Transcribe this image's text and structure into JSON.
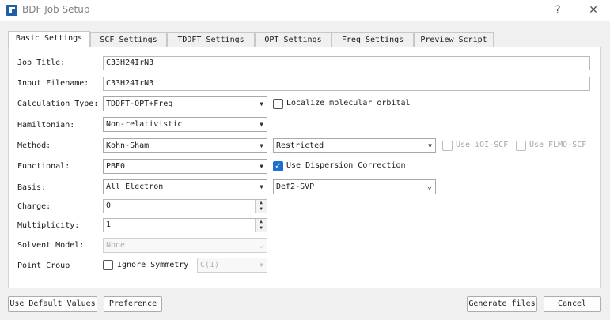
{
  "window": {
    "title": "BDF Job Setup",
    "help_glyph": "?",
    "close_glyph": "✕",
    "icon": "bdf-app-icon"
  },
  "tabs": [
    {
      "label": "Basic Settings",
      "active": true
    },
    {
      "label": "SCF Settings",
      "active": false
    },
    {
      "label": "TDDFT Settings",
      "active": false
    },
    {
      "label": "OPT Settings",
      "active": false
    },
    {
      "label": "Freq Settings",
      "active": false
    },
    {
      "label": "Preview Script",
      "active": false
    }
  ],
  "form": {
    "job_title": {
      "label": "Job Title:",
      "value": "C33H24IrN3"
    },
    "input_filename": {
      "label": "Input Filename:",
      "value": "C33H24IrN3"
    },
    "calculation_type": {
      "label": "Calculation Type:",
      "value": "TDDFT-OPT+Freq"
    },
    "localize_orbital": {
      "label": "Localize molecular orbital",
      "checked": false
    },
    "hamiltonian": {
      "label": "Hamiltonian:",
      "value": "Non-relativistic"
    },
    "method": {
      "label": "Method:",
      "value": "Kohn-Sham",
      "reference": "Restricted"
    },
    "use_ioi_scf": {
      "label": "Use iOI-SCF",
      "checked": false,
      "enabled": false
    },
    "use_flmo_scf": {
      "label": "Use FLMO-SCF",
      "checked": false,
      "enabled": false
    },
    "functional": {
      "label": "Functional:",
      "value": "PBE0"
    },
    "dispersion": {
      "label": "Use Dispersion Correction",
      "checked": true
    },
    "basis": {
      "label": "Basis:",
      "value": "All Electron",
      "basis_set": "Def2-SVP"
    },
    "charge": {
      "label": "Charge:",
      "value": "0"
    },
    "multiplicity": {
      "label": "Multiplicity:",
      "value": "1"
    },
    "solvent_model": {
      "label": "Solvent Model:",
      "value": "None",
      "enabled": false
    },
    "point_group": {
      "label": "Point Croup",
      "ignore_symmetry_label": "Ignore Symmetry",
      "ignore_symmetry_checked": false,
      "value": "C(1)",
      "enabled": false
    }
  },
  "buttons": {
    "use_default": "Use Default Values",
    "preference": "Preference",
    "generate": "Generate files",
    "cancel": "Cancel"
  },
  "colors": {
    "accent": "#1f6fd1",
    "panel_bg": "#ffffff",
    "window_bg": "#f0f0f0"
  }
}
